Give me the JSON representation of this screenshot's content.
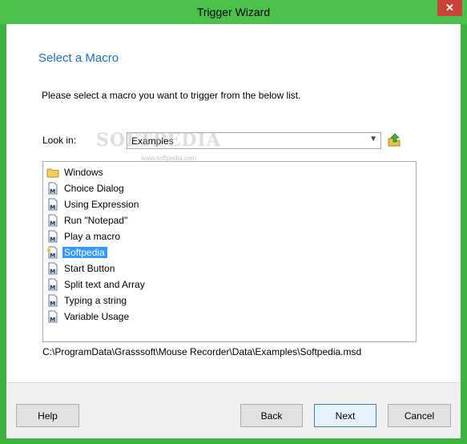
{
  "window": {
    "title": "Trigger Wizard",
    "close_glyph": "✕"
  },
  "page": {
    "heading": "Select a Macro",
    "instruction": "Please select a macro you want to trigger from the below list."
  },
  "look_in": {
    "label": "Look in:",
    "value": "Examples"
  },
  "watermark": {
    "main": "SOFTPEDIA",
    "sub": "www.softpedia.com"
  },
  "list": {
    "items": [
      {
        "label": "Windows",
        "icon": "folder-icon"
      },
      {
        "label": "Choice Dialog",
        "icon": "macro-file-icon"
      },
      {
        "label": "Using Expression",
        "icon": "macro-file-icon"
      },
      {
        "label": "Run \"Notepad\"",
        "icon": "macro-file-icon"
      },
      {
        "label": "Play a macro",
        "icon": "macro-file-icon"
      },
      {
        "label": "Softpedia",
        "icon": "macro-file-star-icon",
        "selected": true
      },
      {
        "label": "Start Button",
        "icon": "macro-file-icon"
      },
      {
        "label": "Split text and Array",
        "icon": "macro-file-icon"
      },
      {
        "label": "Typing a string",
        "icon": "macro-file-icon"
      },
      {
        "label": "Variable Usage",
        "icon": "macro-file-icon"
      }
    ]
  },
  "selected_path": "C:\\ProgramData\\Grasssoft\\Mouse Recorder\\Data\\Examples\\Softpedia.msd",
  "buttons": {
    "help": "Help",
    "back": "Back",
    "next": "Next",
    "cancel": "Cancel"
  },
  "colors": {
    "frame": "#3eb23e",
    "heading": "#1e6fc6",
    "selection": "#3399ff",
    "close": "#c7433b"
  }
}
